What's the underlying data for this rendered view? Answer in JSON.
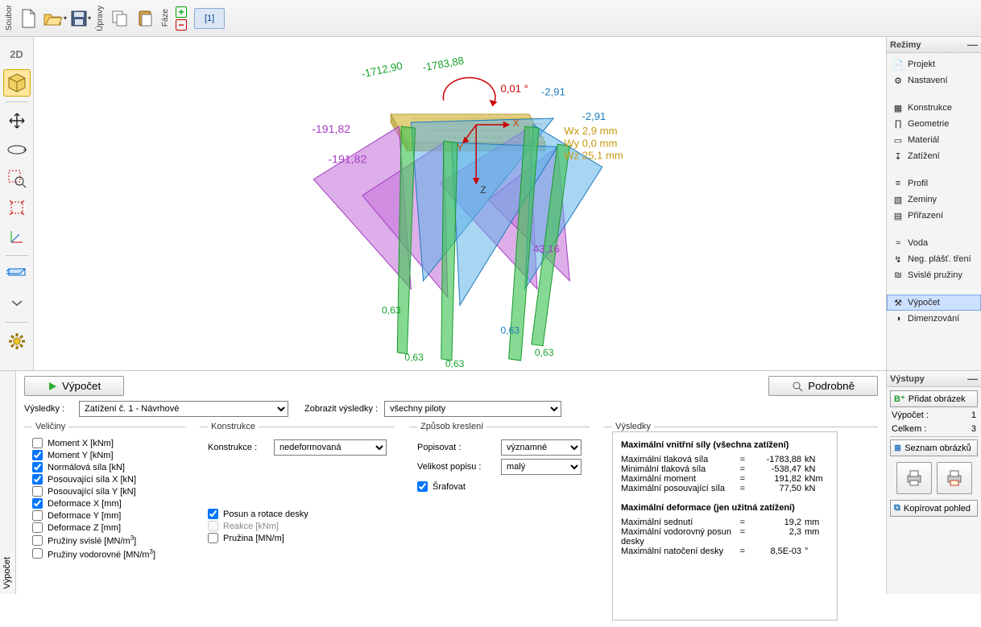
{
  "toolbar": {
    "group_file": "Soubor",
    "group_edit": "Úpravy",
    "group_phase": "Fáze",
    "phase_tab": "[1]"
  },
  "left_tools": [
    "2D",
    "3D",
    "move",
    "rotate",
    "zoom",
    "fit",
    "axes",
    "section",
    "gear"
  ],
  "modes": {
    "title": "Režimy",
    "items": [
      {
        "icon": "doc",
        "label": "Projekt"
      },
      {
        "icon": "gear",
        "label": "Nastavení"
      },
      {
        "icon": "grid",
        "label": "Konstrukce"
      },
      {
        "icon": "cols",
        "label": "Geometrie"
      },
      {
        "icon": "mat",
        "label": "Materiál"
      },
      {
        "icon": "load",
        "label": "Zatížení"
      },
      {
        "icon": "prof",
        "label": "Profil"
      },
      {
        "icon": "soil",
        "label": "Zeminy"
      },
      {
        "icon": "assign",
        "label": "Přiřazení"
      },
      {
        "icon": "water",
        "label": "Voda"
      },
      {
        "icon": "neg",
        "label": "Neg. plášť. tření"
      },
      {
        "icon": "spring",
        "label": "Svislé pružiny"
      },
      {
        "icon": "calc",
        "label": "Výpočet",
        "selected": true
      },
      {
        "icon": "dim",
        "label": "Dimenzování"
      }
    ]
  },
  "canvas": {
    "angle": "0,01 °",
    "top_left_green": "-1712,90",
    "top_mid_green": "-1783,88",
    "wx": "Wx 2,9 mm",
    "wy": "Wy 0,0 mm",
    "wz": "Wz 25,1 mm",
    "blue_tr1": "-2,91",
    "blue_tr2": "-2,91",
    "mag1": "-191,82",
    "mag2": "-191,82",
    "mag3": "43,16",
    "g_b1": "0,63",
    "g_b2": "0,63",
    "g_b3": "0,63",
    "g_b4": "0,63",
    "b_bot": "0,63"
  },
  "bottom": {
    "calc_btn": "Výpočet",
    "detail_btn": "Podrobně",
    "results_label": "Výsledky :",
    "results_select": "Zatížení č. 1 - Návrhové",
    "show_label": "Zobrazit výsledky :",
    "show_select": "všechny piloty",
    "quantities": {
      "legend": "Veličiny",
      "items": [
        {
          "label": "Moment X [kNm]",
          "checked": false
        },
        {
          "label": "Moment Y [kNm]",
          "checked": true
        },
        {
          "label": "Normálová síla [kN]",
          "checked": true
        },
        {
          "label": "Posouvající síla X [kN]",
          "checked": true
        },
        {
          "label": "Posouvající síla Y [kN]",
          "checked": false
        },
        {
          "label": "Deformace X [mm]",
          "checked": true
        },
        {
          "label": "Deformace Y [mm]",
          "checked": false
        },
        {
          "label": "Deformace Z [mm]",
          "checked": false
        },
        {
          "label": "Pružiny svislé [MN/m³]",
          "checked": false,
          "sup": true
        },
        {
          "label": "Pružiny vodorovné [MN/m³]",
          "checked": false,
          "sup": true
        }
      ]
    },
    "construction": {
      "legend": "Konstrukce",
      "label": "Konstrukce :",
      "value": "nedeformovaná",
      "posun": {
        "label": "Posun a rotace desky",
        "checked": true
      },
      "reakce": {
        "label": "Reakce [kNm]",
        "checked": false,
        "disabled": true
      },
      "pruzina": {
        "label": "Pružina [MN/m]",
        "checked": false
      }
    },
    "drawing": {
      "legend": "Způsob kreslení",
      "desc_label": "Popisovat :",
      "desc_value": "významné",
      "size_label": "Velikost popisu :",
      "size_value": "malý",
      "hatch": {
        "label": "Šrafovat",
        "checked": true
      }
    },
    "results": {
      "legend": "Výsledky",
      "h1": "Maximální vnitřní síly (všechna zatížení)",
      "rows1": [
        {
          "l": "Maximální tlaková síla",
          "eq": "=",
          "v": "-1783,88",
          "u": "kN"
        },
        {
          "l": "Minimální tlaková síla",
          "eq": "=",
          "v": "-538,47",
          "u": "kN"
        },
        {
          "l": "Maximální moment",
          "eq": "=",
          "v": "191,82",
          "u": "kNm"
        },
        {
          "l": "Maximální posouvající síla",
          "eq": "=",
          "v": "77,50",
          "u": "kN"
        }
      ],
      "h2": "Maximální deformace (jen užitná zatížení)",
      "rows2": [
        {
          "l": "Maximální sednutí",
          "eq": "=",
          "v": "19,2",
          "u": "mm"
        },
        {
          "l": "Maximální vodorovný posun desky",
          "eq": "=",
          "v": "2,3",
          "u": "mm"
        },
        {
          "l": "Maximální natočení desky",
          "eq": "=",
          "v": "8,5E-03",
          "u": "°"
        }
      ]
    }
  },
  "outputs": {
    "title": "Výstupy",
    "add_img": "Přidat obrázek",
    "r1": {
      "l": "Výpočet :",
      "v": "1"
    },
    "r2": {
      "l": "Celkem :",
      "v": "3"
    },
    "list": "Seznam obrázků",
    "copy": "Kopírovat pohled"
  },
  "tab_label": "Výpočet"
}
